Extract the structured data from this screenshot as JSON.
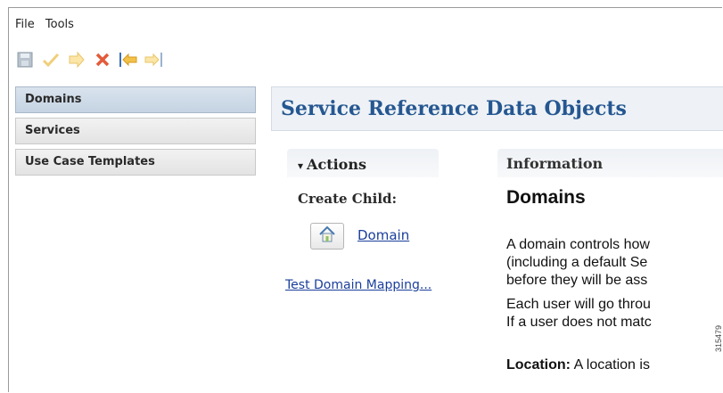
{
  "menu": {
    "file": "File",
    "tools": "Tools"
  },
  "toolbar": {
    "items": [
      {
        "icon": "save-icon",
        "color": "#9aa7b5"
      },
      {
        "icon": "check-icon",
        "color": "#f1d58a"
      },
      {
        "icon": "forward-arrow-icon",
        "color": "#f1d58a"
      },
      {
        "icon": "delete-icon",
        "color": "#e05a3a"
      },
      {
        "icon": "import-icon",
        "color": "#e0a21f"
      },
      {
        "icon": "export-icon",
        "color": "#f1d58a"
      }
    ]
  },
  "sidebar": {
    "items": [
      {
        "label": "Domains",
        "active": true
      },
      {
        "label": "Services",
        "active": false
      },
      {
        "label": "Use Case Templates",
        "active": false
      }
    ]
  },
  "main": {
    "title": "Service Reference Data Objects",
    "actions": {
      "header": "Actions",
      "arrow": "▾",
      "create_child": "Create Child:",
      "domain_link": "Domain",
      "test_link": "Test Domain Mapping..."
    },
    "information": {
      "header": "Information",
      "title": "Domains",
      "p1_l1": "A domain controls how",
      "p1_l2": "(including a default Se",
      "p1_l3": "before they will be ass",
      "p2_l1": "Each user will go throu",
      "p2_l2": "If a user does not matc",
      "p3_bold": "Location:",
      "p3_rest": " A location is"
    }
  },
  "figure_number": "315479"
}
